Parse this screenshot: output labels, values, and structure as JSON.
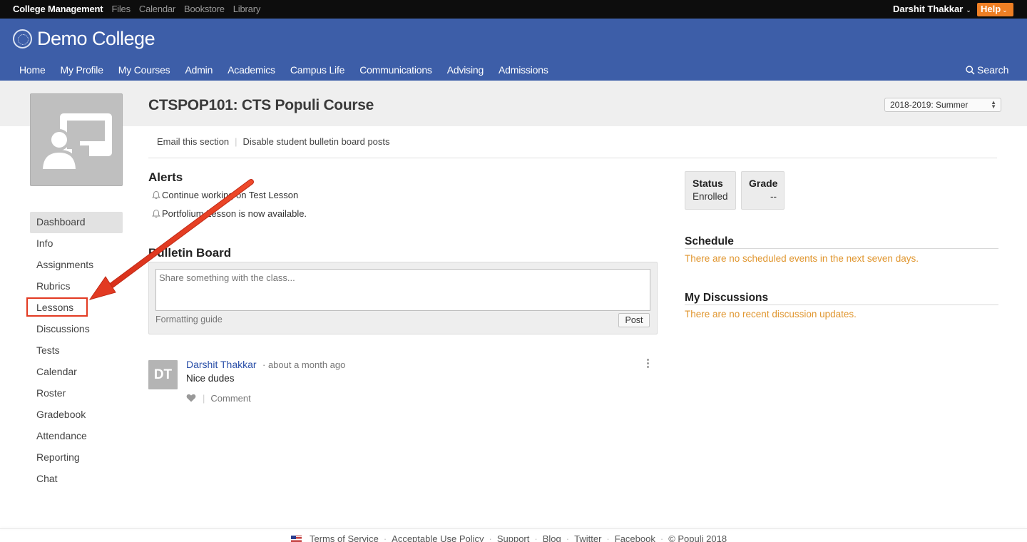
{
  "topbar": {
    "app_name": "College Management",
    "links": [
      "Files",
      "Calendar",
      "Bookstore",
      "Library"
    ],
    "user_name": "Darshit Thakkar",
    "help_label": "Help"
  },
  "header": {
    "college_name": "Demo College",
    "nav": [
      "Home",
      "My Profile",
      "My Courses",
      "Admin",
      "Academics",
      "Campus Life",
      "Communications",
      "Advising",
      "Admissions"
    ],
    "search_label": "Search"
  },
  "course": {
    "title": "CTSPOP101: CTS Populi Course",
    "term": "2018-2019: Summer"
  },
  "sidebar": {
    "items": [
      {
        "label": "Dashboard"
      },
      {
        "label": "Info"
      },
      {
        "label": "Assignments"
      },
      {
        "label": "Rubrics"
      },
      {
        "label": "Lessons"
      },
      {
        "label": "Discussions"
      },
      {
        "label": "Tests"
      },
      {
        "label": "Calendar"
      },
      {
        "label": "Roster"
      },
      {
        "label": "Gradebook"
      },
      {
        "label": "Attendance"
      },
      {
        "label": "Reporting"
      },
      {
        "label": "Chat"
      }
    ]
  },
  "section_links": {
    "email": "Email this section",
    "disable": "Disable student bulletin board posts"
  },
  "alerts": {
    "heading": "Alerts",
    "items": [
      "Continue working on Test Lesson",
      "Portfolium Lesson is now available."
    ]
  },
  "bulletin": {
    "heading": "Bulletin Board",
    "placeholder": "Share something with the class...",
    "formatting_guide": "Formatting guide",
    "post_button": "Post"
  },
  "post": {
    "initials": "DT",
    "author": "Darshit Thakkar",
    "meta": "· about a month ago",
    "body": "Nice dudes",
    "comment_label": "Comment"
  },
  "status_card": {
    "label": "Status",
    "value": "Enrolled"
  },
  "grade_card": {
    "label": "Grade",
    "value": "--"
  },
  "schedule": {
    "heading": "Schedule",
    "empty": "There are no scheduled events in the next seven days."
  },
  "discussions": {
    "heading": "My Discussions",
    "empty": "There are no recent discussion updates."
  },
  "footer": {
    "links": [
      "Terms of Service",
      "Acceptable Use Policy",
      "Support",
      "Blog",
      "Twitter",
      "Facebook",
      "© Populi 2018"
    ]
  },
  "colors": {
    "header_blue": "#3d5ea8",
    "help_orange": "#ef7f24",
    "annotation_red": "#e23a22",
    "empty_message": "#e0962f",
    "author_link": "#2a4fa8"
  }
}
